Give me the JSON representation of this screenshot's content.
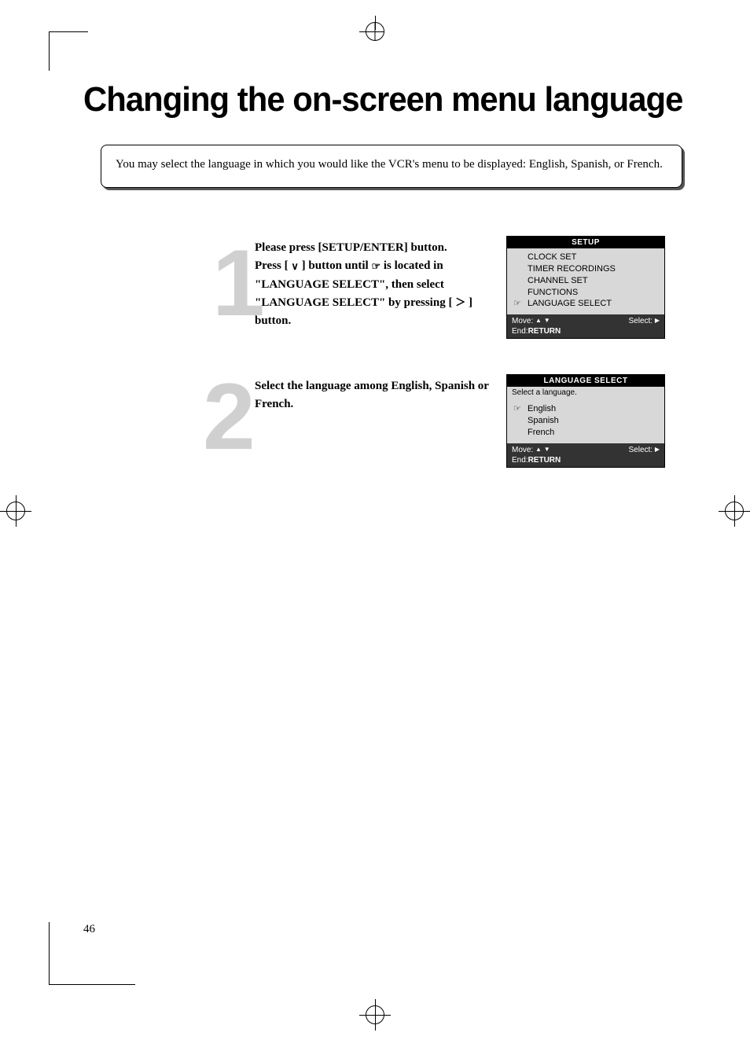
{
  "page": {
    "title": "Changing the on-screen menu language",
    "intro": "You may select the language in which you would like the VCR's menu to be displayed: English, Spanish, or French.",
    "page_number": "46"
  },
  "steps": {
    "s1": {
      "number": "1",
      "line1": "Please press [SETUP/ENTER] button.",
      "line2a": "Press [ ",
      "line2b": " ] button until   ",
      "line2c": "   is located in",
      "line3": "\"LANGUAGE SELECT\", then select",
      "line4": "\"LANGUAGE SELECT\" by pressing [ ",
      "line4b": " ]",
      "line5": "button."
    },
    "s2": {
      "number": "2",
      "text": "Select the language among English, Spanish or French."
    }
  },
  "osd_setup": {
    "header": "SETUP",
    "items": {
      "i0": "CLOCK SET",
      "i1": "TIMER RECORDINGS",
      "i2": "CHANNEL SET",
      "i3": "FUNCTIONS",
      "i4": "LANGUAGE SELECT"
    },
    "footer_move": "Move: ",
    "footer_select": "Select: ",
    "footer_end": "End:",
    "footer_return": "RETURN"
  },
  "osd_lang": {
    "header": "LANGUAGE SELECT",
    "prompt": "Select a language.",
    "items": {
      "i0": "English",
      "i1": "Spanish",
      "i2": "French"
    },
    "footer_move": "Move: ",
    "footer_select": "Select: ",
    "footer_end": "End:",
    "footer_return": "RETURN"
  },
  "glyphs": {
    "down": "∨",
    "right": "＞",
    "pointer": "☞",
    "tri_up": "▲",
    "tri_down": "▼",
    "tri_right": "▶"
  }
}
